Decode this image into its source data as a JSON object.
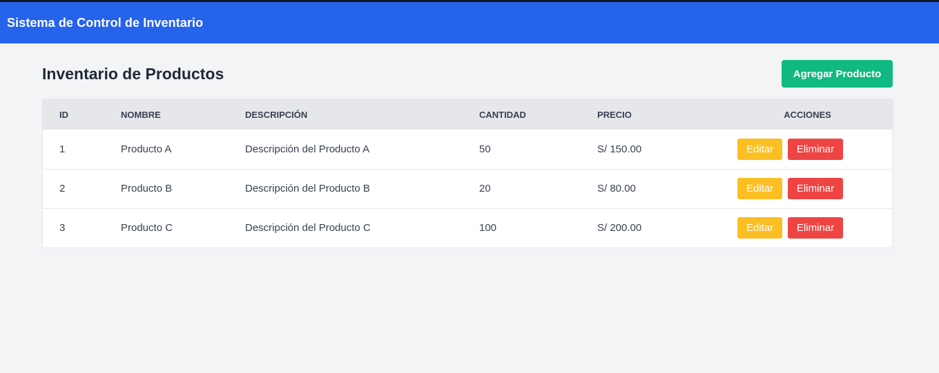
{
  "navbar": {
    "brand": "Sistema de Control de Inventario"
  },
  "main": {
    "title": "Inventario de Productos",
    "add_button": "Agregar Producto",
    "table": {
      "headers": {
        "id": "ID",
        "name": "NOMBRE",
        "description": "DESCRIPCIÓN",
        "quantity": "CANTIDAD",
        "price": "PRECIO",
        "actions": "ACCIONES"
      },
      "rows": [
        {
          "id": "1",
          "name": "Producto A",
          "description": "Descripción del Producto A",
          "quantity": "50",
          "price": "S/ 150.00",
          "edit": "Editar",
          "delete": "Eliminar"
        },
        {
          "id": "2",
          "name": "Producto B",
          "description": "Descripción del Producto B",
          "quantity": "20",
          "price": "S/ 80.00",
          "edit": "Editar",
          "delete": "Eliminar"
        },
        {
          "id": "3",
          "name": "Producto C",
          "description": "Descripción del Producto C",
          "quantity": "100",
          "price": "S/ 200.00",
          "edit": "Editar",
          "delete": "Eliminar"
        }
      ]
    }
  },
  "colors": {
    "navbar": "#2563eb",
    "add_button": "#10b981",
    "edit_button": "#fbbf24",
    "delete_button": "#ef4444",
    "page_background": "#f3f4f6"
  }
}
